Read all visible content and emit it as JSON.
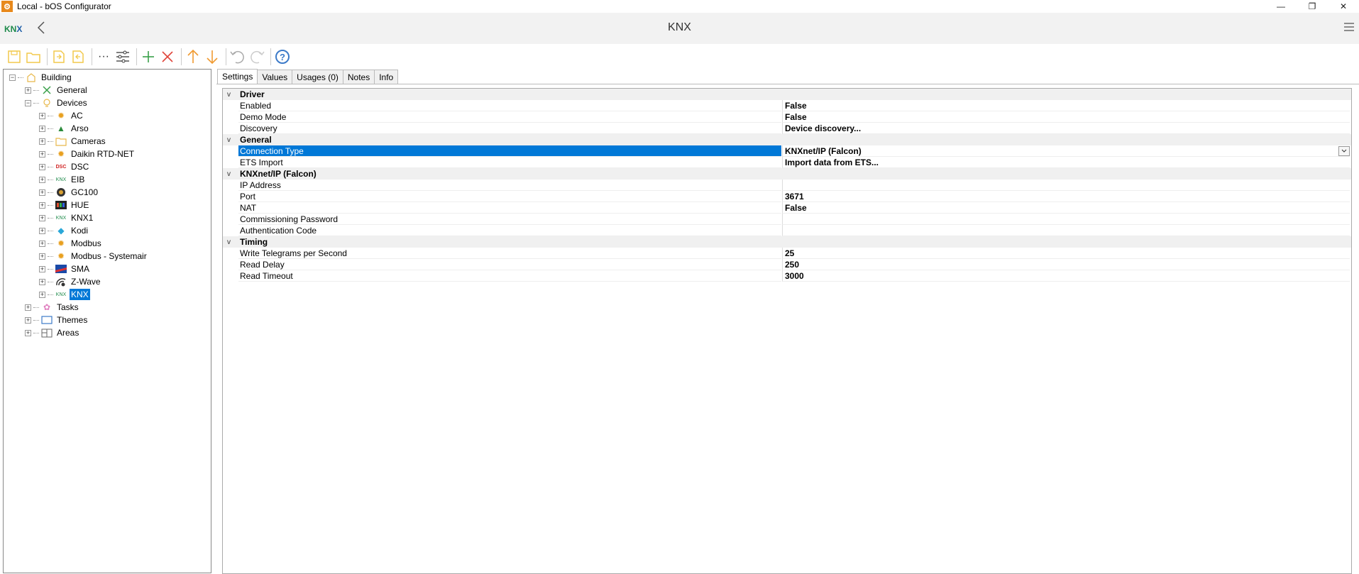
{
  "window": {
    "title": "Local - bOS Configurator",
    "minimize": "—",
    "restore": "❐",
    "close": "✕"
  },
  "header": {
    "logo_k": "KN",
    "logo_x": "X",
    "title": "KNX",
    "back_icon": "chevron-left-icon",
    "menu_icon": "hamburger-icon"
  },
  "toolbar": {
    "more": "···"
  },
  "tree": {
    "root": "Building",
    "general": "General",
    "devices": "Devices",
    "device_items": [
      "AC",
      "Arso",
      "Cameras",
      "Daikin RTD-NET",
      "DSC",
      "EIB",
      "GC100",
      "HUE",
      "KNX1",
      "Kodi",
      "Modbus",
      "Modbus - Systemair",
      "SMA",
      "Z-Wave",
      "KNX"
    ],
    "tasks": "Tasks",
    "themes": "Themes",
    "areas": "Areas"
  },
  "tabs": [
    "Settings",
    "Values",
    "Usages (0)",
    "Notes",
    "Info"
  ],
  "grid": {
    "driver": {
      "label": "Driver",
      "rows": [
        {
          "name": "Enabled",
          "value": "False"
        },
        {
          "name": "Demo Mode",
          "value": "False"
        },
        {
          "name": "Discovery",
          "value": "Device discovery..."
        }
      ]
    },
    "general": {
      "label": "General",
      "rows": [
        {
          "name": "Connection Type",
          "value": "KNXnet/IP (Falcon)"
        },
        {
          "name": "ETS Import",
          "value": "Import data from ETS..."
        }
      ]
    },
    "knxnet": {
      "label": "KNXnet/IP (Falcon)",
      "rows": [
        {
          "name": "IP Address",
          "value": ""
        },
        {
          "name": "Port",
          "value": "3671"
        },
        {
          "name": "NAT",
          "value": "False"
        },
        {
          "name": "Commissioning Password",
          "value": ""
        },
        {
          "name": "Authentication Code",
          "value": ""
        }
      ]
    },
    "timing": {
      "label": "Timing",
      "rows": [
        {
          "name": "Write Telegrams per Second",
          "value": "25"
        },
        {
          "name": "Read Delay",
          "value": "250"
        },
        {
          "name": "Read Timeout",
          "value": "3000"
        }
      ]
    }
  },
  "colors": {
    "selection": "#0078d7",
    "accent_orange": "#e8891c"
  }
}
